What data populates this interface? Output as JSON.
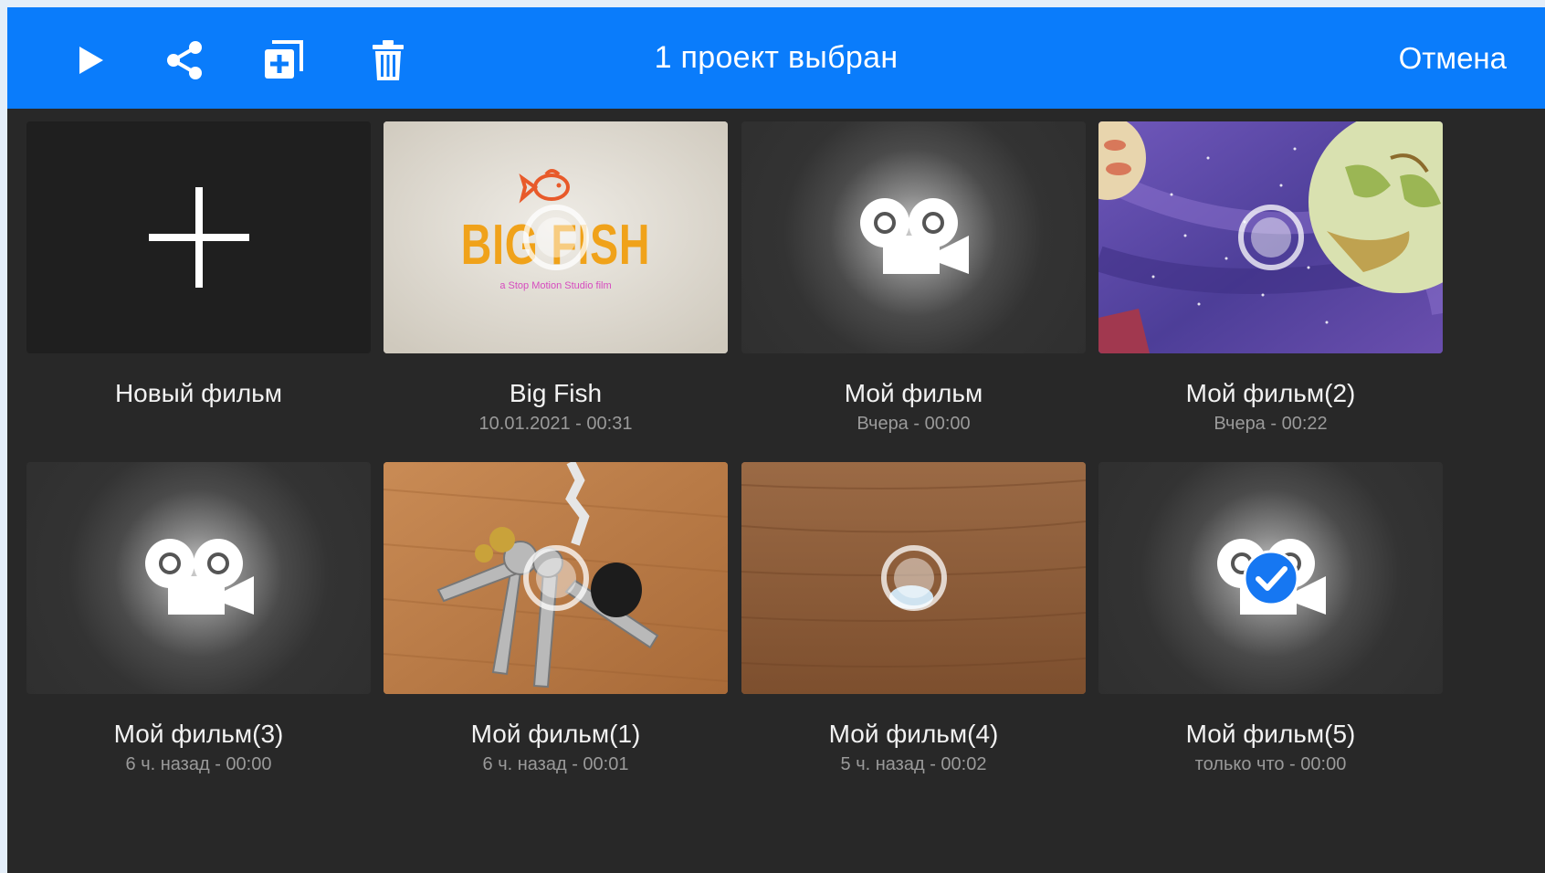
{
  "toolbar": {
    "title": "1 проект выбран",
    "cancel_label": "Отмена",
    "background": "#0a7cfb"
  },
  "new_film": {
    "label": "Новый фильм"
  },
  "projects": [
    {
      "name": "Big Fish",
      "date": "10.01.2021 - 00:31",
      "thumbnail": "big-fish-title"
    },
    {
      "name": "Мой фильм",
      "date": "Вчера - 00:00",
      "thumbnail": "camera-placeholder"
    },
    {
      "name": "Мой фильм(2)",
      "date": "Вчера - 00:22",
      "thumbnail": "purple-space-drawing"
    },
    {
      "name": "Мой фильм(3)",
      "date": "6 ч. назад - 00:00",
      "thumbnail": "camera-placeholder"
    },
    {
      "name": "Мой фильм(1)",
      "date": "6 ч. назад - 00:01",
      "thumbnail": "keys-on-table"
    },
    {
      "name": "Мой фильм(4)",
      "date": "5 ч. назад - 00:02",
      "thumbnail": "wood-table"
    },
    {
      "name": "Мой фильм(5)",
      "date": "только что - 00:00",
      "thumbnail": "camera-placeholder",
      "selected": true
    }
  ],
  "thumbnail_text": {
    "big_fish_logo": "BIG FISH",
    "big_fish_caption": "a Stop Motion Studio film"
  },
  "colors": {
    "accent": "#0a7cfb",
    "background": "#282828",
    "selected_check": "#1677f2"
  }
}
